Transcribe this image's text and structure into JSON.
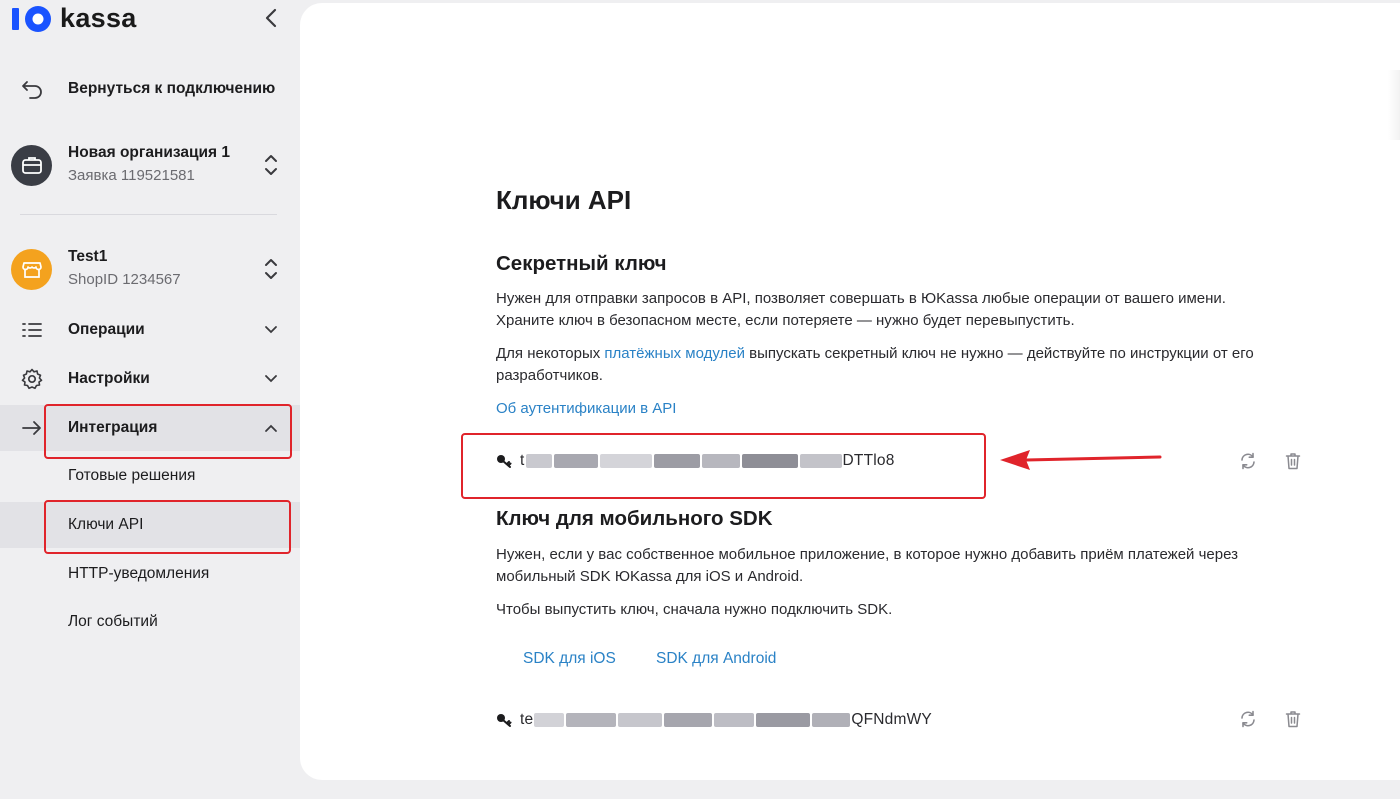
{
  "app": {
    "logo_text": "kassa",
    "brand_color": "#1a53ff"
  },
  "sidebar": {
    "back_label": "Вернуться к подключению",
    "org": {
      "name": "Новая организация 1",
      "request": "Заявка 119521581"
    },
    "shop": {
      "name": "Test1",
      "shop_id": "ShopID 1234567"
    },
    "menu": {
      "operations": "Операции",
      "settings": "Настройки",
      "integration": "Интеграция"
    },
    "integration_items": [
      {
        "label": "Готовые решения"
      },
      {
        "label": "Ключи API"
      },
      {
        "label": "HTTP-уведомления"
      },
      {
        "label": "Лог событий"
      }
    ]
  },
  "main": {
    "title": "Ключи API",
    "secret": {
      "heading": "Секретный ключ",
      "desc_line1": "Нужен для отправки запросов в API, позволяет совершать в ЮKassa любые операции от вашего имени.",
      "desc_line2": "Храните ключ в безопасном месте, если потеряете — нужно будет перевыпустить.",
      "modules_prefix": "Для некоторых ",
      "modules_link": "платёжных модулей",
      "modules_suffix": " выпускать секретный ключ не нужно — действуйте по инструкции от его",
      "modules_line2": "разработчиков.",
      "auth_link": "Об аутентификации в API",
      "key_prefix": "t",
      "key_suffix": "DTTlo8"
    },
    "mobile": {
      "heading": "Ключ для мобильного SDK",
      "desc_line1": "Нужен, если у вас собственное мобильное приложение, в которое нужно добавить приём платежей через",
      "desc_line2": "мобильный SDK ЮKassa для iOS и Android.",
      "hint": "Чтобы выпустить ключ, сначала нужно подключить SDK.",
      "sdk_ios": "SDK для iOS",
      "sdk_android": "SDK для Android",
      "key_prefix": "te",
      "key_suffix": "QFNdmWY"
    }
  },
  "colors": {
    "highlight": "#e0242b",
    "link": "#2a82c6",
    "active_bg": "#e2e2e6"
  }
}
